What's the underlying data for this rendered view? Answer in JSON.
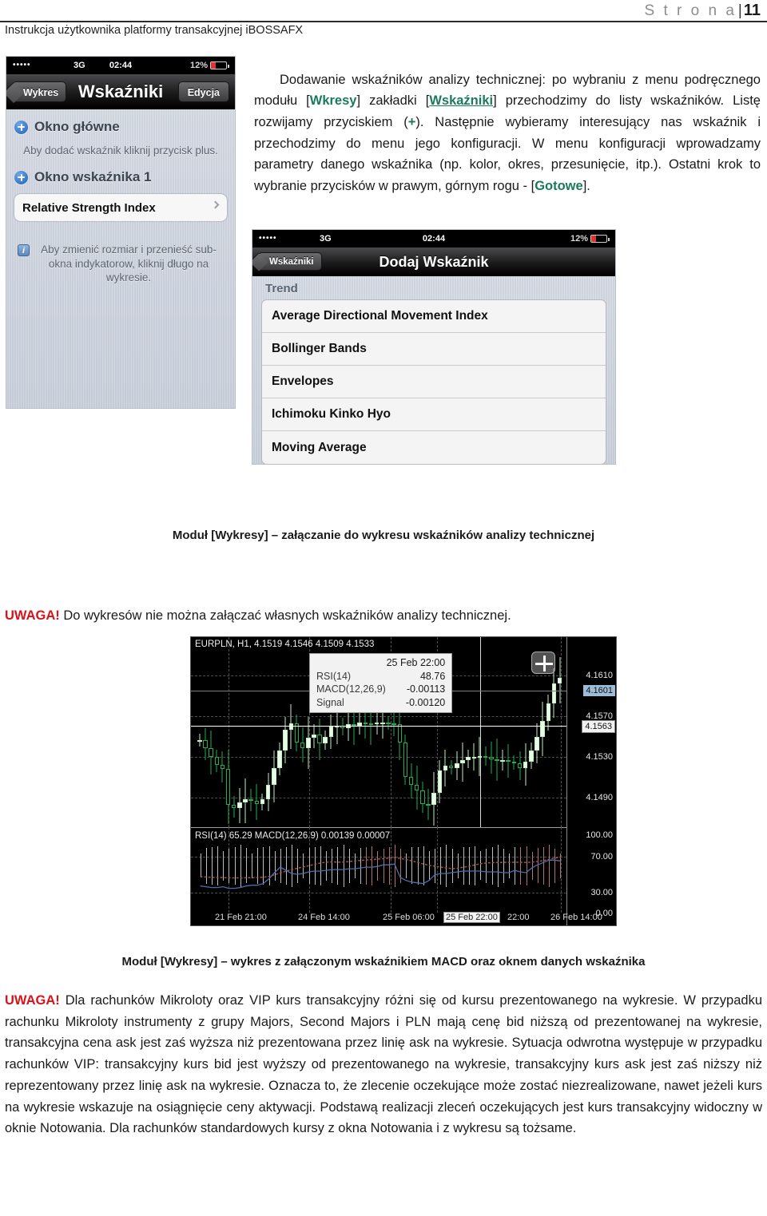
{
  "page_header": {
    "label": "S t r o n a",
    "separator": "|",
    "number": "11",
    "subtitle": "Instrukcja użytkownika platformy transakcyjnej iBOSSAFX"
  },
  "intro_paragraph": {
    "part1": "Dodawanie wskaźników analizy technicznej: po wybraniu z menu podręcznego modułu [",
    "hl1": "Wkresy",
    "part2": "] zakładki [",
    "hl2": "Wskaźniki",
    "part3": "] przechodzimy do listy wskaźników. Listę rozwijamy przyciskiem (",
    "hl3": "+",
    "part4": "). Następnie wybieramy interesujący nas wskaźnik i przechodzimy do menu jego konfiguracji. W menu konfiguracji wprowadzamy parametry danego wskaźnika (np. kolor, okres, przesunięcie, itp.). Ostatni krok to wybranie przycisków w prawym, górnym rogu - [",
    "hl4": "Gotowe",
    "part5": "]."
  },
  "phone_indicators": {
    "status": {
      "signal_dots": "•••••",
      "carrier": "3G",
      "clock": "02:44",
      "battery_pct": "12%"
    },
    "navbar": {
      "back_label": "Wykres",
      "title": "Wskaźniki",
      "action_label": "Edycja"
    },
    "groups": [
      {
        "title": "Okno główne",
        "note": "Aby dodać wskaźnik kliknij przycisk plus."
      },
      {
        "title": "Okno wskaźnika 1",
        "cell": "Relative Strength Index"
      }
    ],
    "info_note": "Aby zmienić rozmiar i przenieść sub-okna indykatorow, kliknij długo na wykresie."
  },
  "phone_add_indicator": {
    "status": {
      "signal_dots": "•••••",
      "carrier": "3G",
      "clock": "02:44",
      "battery_pct": "12%"
    },
    "navbar": {
      "back_label": "Wskaźniki",
      "title": "Dodaj Wskaźnik"
    },
    "section_label": "Trend",
    "items": [
      "Average Directional Movement Index",
      "Bollinger Bands",
      "Envelopes",
      "Ichimoku Kinko Hyo",
      "Moving Average"
    ]
  },
  "caption_1": "Moduł [Wykresy] – załączanie do wykresu wskaźników analizy technicznej",
  "warning_1": {
    "label": "UWAGA!",
    "text": " Do wykresów nie można załączać własnych wskaźników analizy technicznej."
  },
  "caption_2": "Moduł [Wykresy] – wykres z załączonym wskaźnikiem MACD oraz oknem danych wskaźnika",
  "warning_2": {
    "label": "UWAGA!",
    "text": " Dla rachunków Mikroloty oraz VIP kurs transakcyjny różni się od kursu prezentowanego na wykresie. W przypadku rachunku Mikroloty instrumenty z grupy Majors, Second Majors i PLN mają cenę bid niższą od prezentowanej na wykresie, transakcyjna cena ask jest zaś wyższa niż prezentowana przez linię ask na wykresie. Sytuacja odwrotna występuje w przypadku rachunków VIP: transakcyjny kurs bid jest wyższy od prezentowanego na wykresie, transakcyjny kurs ask jest zaś niższy niż reprezentowany przez linię ask na wykresie. Oznacza to, że zlecenie oczekujące może zostać niezrealizowane, nawet jeżeli kurs na wykresie wskazuje na osiągnięcie ceny aktywacji. Podstawą realizacji zleceń oczekujących jest kurs transakcyjny widoczny w oknie Notowania. Dla rachunków standardowych kursy z okna Notowania i z wykresu są tożsame."
  },
  "chart_data": {
    "type": "line",
    "title": "EURPLN, H1, 4.1519 4.1546 4.1509 4.1533",
    "symbol": "EURPLN",
    "timeframe": "H1",
    "ohlc": {
      "open": "4.1519",
      "high": "4.1546",
      "low": "4.1509",
      "close": "4.1533"
    },
    "sub_header": "RSI(14) 65.29 MACD(12,26.9) 0.00139 0.00007",
    "price_axis_labels": [
      "4.1610",
      "4.1570",
      "4.1530",
      "4.1490"
    ],
    "price_marker_bid": "4.1601",
    "price_marker_ask": "4.1563",
    "indicator_axis_labels": [
      "100.00",
      "70.00",
      "30.00",
      "0.00"
    ],
    "x_axis_labels": [
      "21 Feb 21:00",
      "24 Feb 14:00",
      "25 Feb 06:00",
      "22:00",
      "26 Feb 14:00"
    ],
    "x_axis_selected": "25 Feb 22:00",
    "data_window": {
      "timestamp": "25 Feb 22:00",
      "rows": [
        {
          "label": "RSI(14)",
          "value": "48.76"
        },
        {
          "label": "MACD(12,26,9)",
          "value": "-0.00113"
        },
        {
          "label": "Signal",
          "value": "-0.00120"
        }
      ]
    },
    "ylim_price": [
      4.147,
      4.163
    ],
    "ylim_indicator": [
      0,
      100
    ],
    "grid": true,
    "series": [
      {
        "name": "RSI(14)",
        "color": "#4a6fb0"
      },
      {
        "name": "MACD Signal",
        "color": "#a05552"
      }
    ],
    "candles_close": [
      4.1545,
      4.1538,
      4.153,
      4.1523,
      4.1519,
      4.1487,
      4.1484,
      4.1489,
      4.1492,
      4.1491,
      4.1488,
      4.1492,
      4.1505,
      4.152,
      4.1536,
      4.1554,
      4.156,
      4.1543,
      4.1538,
      4.1547,
      4.155,
      4.1542,
      4.1548,
      4.1557,
      4.1558,
      4.1556,
      4.1559,
      4.1558,
      4.1561,
      4.156,
      4.1559,
      4.1561,
      4.1561,
      4.156,
      4.1559,
      4.1543,
      4.1512,
      4.1505,
      4.15,
      4.1488,
      4.1487,
      4.1498,
      4.1518,
      4.1522,
      4.152,
      4.1524,
      4.1527,
      4.153,
      4.153,
      4.1531,
      4.153,
      4.1528,
      4.1527,
      4.1527,
      4.1526,
      4.1524,
      4.152,
      4.1526,
      4.1536,
      4.1548,
      4.1562,
      4.1578,
      4.1596,
      4.1601
    ],
    "rsi_values": [
      33,
      32,
      31,
      31,
      32,
      30,
      30,
      31,
      33,
      34,
      34,
      36,
      42,
      50,
      57,
      53,
      49,
      48,
      49,
      51,
      52,
      52,
      53,
      54,
      54,
      54,
      55,
      55,
      56,
      57,
      57,
      58,
      60,
      60,
      61,
      44,
      40,
      38,
      37,
      36,
      40,
      47,
      49,
      49,
      50,
      51,
      52,
      52,
      52,
      52,
      51,
      51,
      51,
      50,
      50,
      53,
      51,
      50,
      56,
      60,
      63,
      66,
      66,
      65
    ],
    "macd_hist_color_positive": "#bdbdbd"
  }
}
